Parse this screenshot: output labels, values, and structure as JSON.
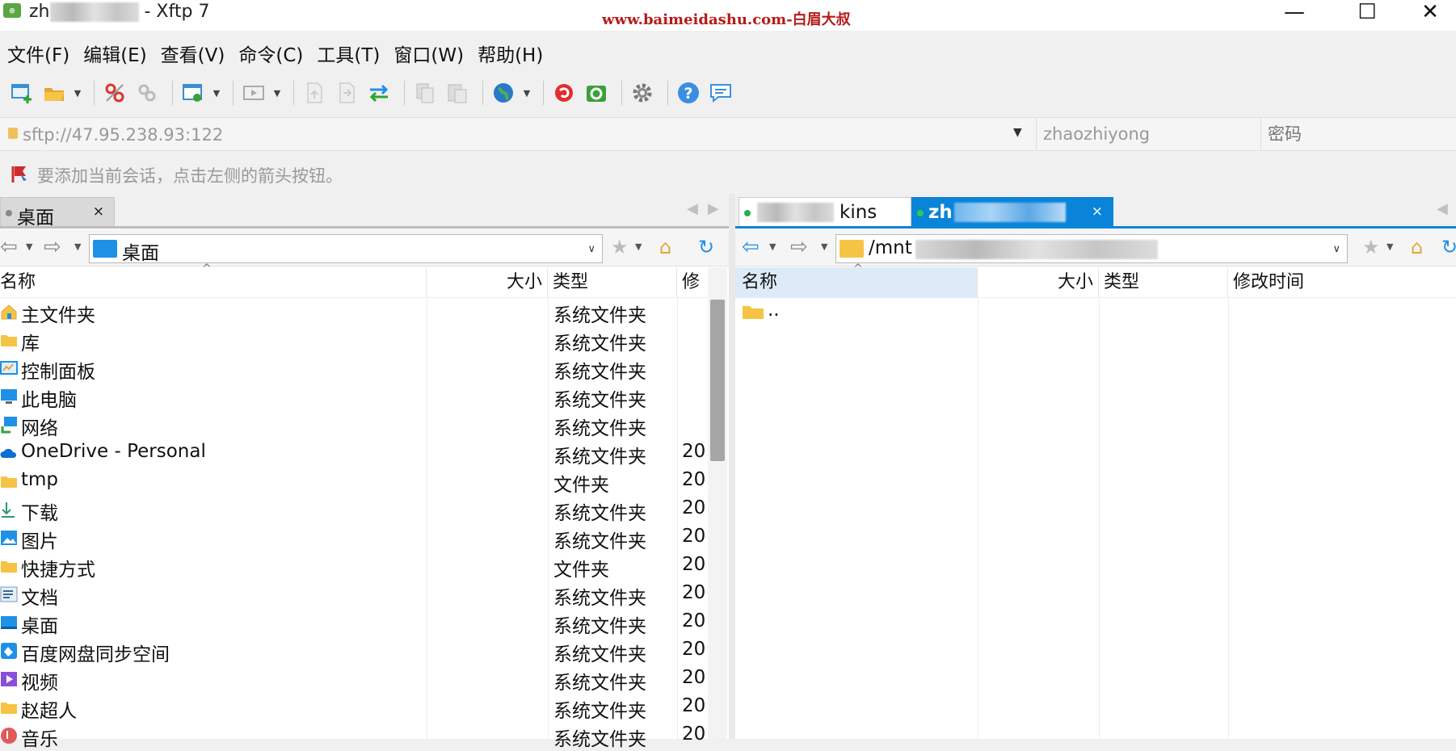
{
  "title": {
    "prefix": "zh",
    "suffix": "- Xftp 7",
    "watermark": "www.baimeidashu.com-白眉大叔",
    "minimize": "—",
    "maximize": "☐",
    "close": "✕"
  },
  "menu": [
    {
      "label": "文件(F)"
    },
    {
      "label": "编辑(E)"
    },
    {
      "label": "查看(V)"
    },
    {
      "label": "命令(C)"
    },
    {
      "label": "工具(T)"
    },
    {
      "label": "窗口(W)"
    },
    {
      "label": "帮助(H)"
    }
  ],
  "toolbar": [
    {
      "name": "new-session-icon"
    },
    {
      "name": "open-folder-icon",
      "dropdown": true
    },
    {
      "name": "disconnect-icon"
    },
    {
      "name": "reconnect-icon"
    },
    {
      "name": "session-settings-icon",
      "dropdown": true
    },
    {
      "name": "play-icon",
      "dropdown": true
    },
    {
      "name": "upload-file-icon"
    },
    {
      "name": "download-file-icon"
    },
    {
      "name": "sync-transfer-icon"
    },
    {
      "name": "copy-icon"
    },
    {
      "name": "paste-icon"
    },
    {
      "name": "globe-icon",
      "dropdown": true
    },
    {
      "name": "xshell-icon"
    },
    {
      "name": "xftp-icon"
    },
    {
      "name": "gear-icon"
    },
    {
      "name": "help-icon"
    },
    {
      "name": "chat-icon"
    }
  ],
  "address": {
    "url": "sftp://47.95.238.93:122",
    "username": "zhaozhiyong",
    "password_placeholder": "密码"
  },
  "hint": {
    "text": "要添加当前会话，点击左侧的箭头按钮。"
  },
  "left_pane": {
    "tab_label": "桌面",
    "tab_close": "×",
    "path": "桌面",
    "columns": {
      "name": "名称",
      "size": "大小",
      "type": "类型",
      "modified": "修"
    },
    "files": [
      {
        "name": "主文件夹",
        "type": "系统文件夹",
        "date": "",
        "icon": "home-icon"
      },
      {
        "name": "库",
        "type": "系统文件夹",
        "date": "",
        "icon": "folder-icon"
      },
      {
        "name": "控制面板",
        "type": "系统文件夹",
        "date": "",
        "icon": "control-panel-icon"
      },
      {
        "name": "此电脑",
        "type": "系统文件夹",
        "date": "",
        "icon": "computer-icon"
      },
      {
        "name": "网络",
        "type": "系统文件夹",
        "date": "",
        "icon": "network-icon"
      },
      {
        "name": "OneDrive - Personal",
        "type": "系统文件夹",
        "date": "20",
        "icon": "cloud-icon"
      },
      {
        "name": "tmp",
        "type": "文件夹",
        "date": "20",
        "icon": "folder-icon"
      },
      {
        "name": "下载",
        "type": "系统文件夹",
        "date": "20",
        "icon": "download-icon"
      },
      {
        "name": "图片",
        "type": "系统文件夹",
        "date": "20",
        "icon": "pictures-icon"
      },
      {
        "name": "快捷方式",
        "type": "文件夹",
        "date": "20",
        "icon": "folder-icon"
      },
      {
        "name": "文档",
        "type": "系统文件夹",
        "date": "20",
        "icon": "documents-icon"
      },
      {
        "name": "桌面",
        "type": "系统文件夹",
        "date": "20",
        "icon": "desktop-icon"
      },
      {
        "name": "百度网盘同步空间",
        "type": "系统文件夹",
        "date": "20",
        "icon": "baidu-netdisk-icon"
      },
      {
        "name": "视频",
        "type": "系统文件夹",
        "date": "20",
        "icon": "video-icon"
      },
      {
        "name": "赵超人",
        "type": "系统文件夹",
        "date": "20",
        "icon": "folder-icon"
      },
      {
        "name": "音乐",
        "type": "系统文件夹",
        "date": "20",
        "icon": "music-icon"
      }
    ]
  },
  "right_pane": {
    "tab1_label": "kins",
    "tab2_label": "zh",
    "tab_close": "×",
    "path": "/mnt",
    "columns": {
      "name": "名称",
      "size": "大小",
      "type": "类型",
      "modified": "修改时间"
    },
    "files": [
      {
        "name": "..",
        "icon": "folder-icon"
      }
    ]
  },
  "colors": {
    "accent_blue": "#1e90e6",
    "active_tab": "#0a84d8",
    "folder_yellow": "#f6c445",
    "watermark_red": "#b51a1a"
  }
}
